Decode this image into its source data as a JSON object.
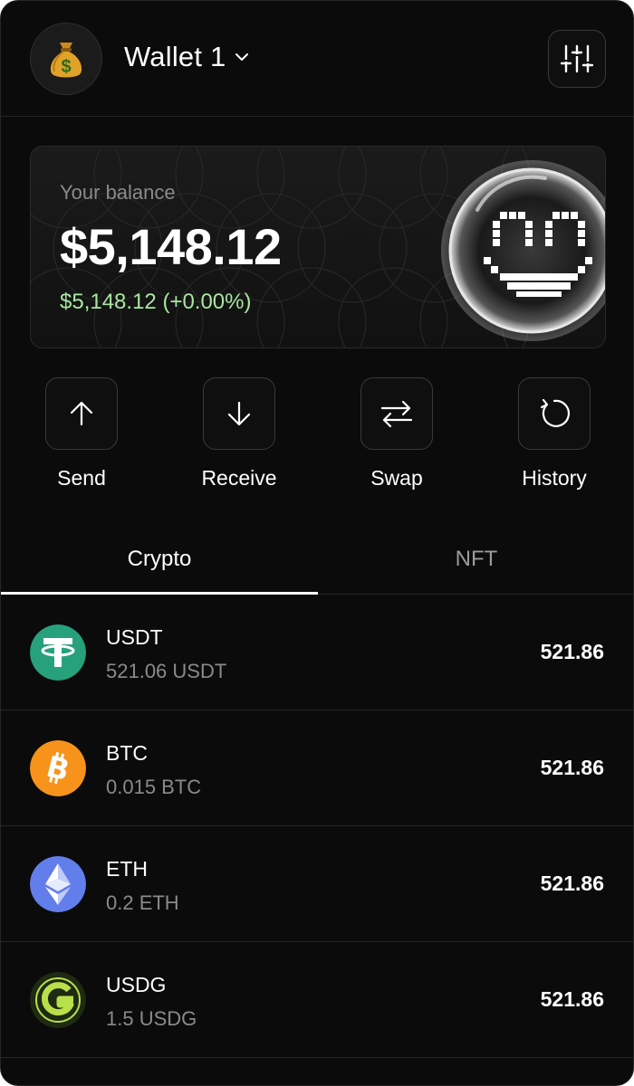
{
  "header": {
    "wallet_name": "Wallet 1",
    "avatar_icon": "money-bag-icon",
    "settings_icon": "sliders-icon"
  },
  "balance": {
    "label": "Your balance",
    "amount": "$5,148.12",
    "change": "$5,148.12 (+0.00%)",
    "change_color": "#a8e6a0"
  },
  "actions": [
    {
      "label": "Send",
      "icon": "arrow-up-icon"
    },
    {
      "label": "Receive",
      "icon": "arrow-down-icon"
    },
    {
      "label": "Swap",
      "icon": "swap-icon"
    },
    {
      "label": "History",
      "icon": "history-icon"
    }
  ],
  "tabs": [
    {
      "label": "Crypto",
      "active": true
    },
    {
      "label": "NFT",
      "active": false
    }
  ],
  "assets": [
    {
      "symbol": "USDT",
      "amount": "521.06 USDT",
      "value": "521.86",
      "icon": "tether-icon",
      "color": "#26a17b"
    },
    {
      "symbol": "BTC",
      "amount": "0.015 BTC",
      "value": "521.86",
      "icon": "bitcoin-icon",
      "color": "#f7931a"
    },
    {
      "symbol": "ETH",
      "amount": "0.2 ETH",
      "value": "521.86",
      "icon": "ethereum-icon",
      "color": "#627eea"
    },
    {
      "symbol": "USDG",
      "amount": "1.5 USDG",
      "value": "521.86",
      "icon": "usdg-icon",
      "color": "#1f2a12"
    }
  ]
}
